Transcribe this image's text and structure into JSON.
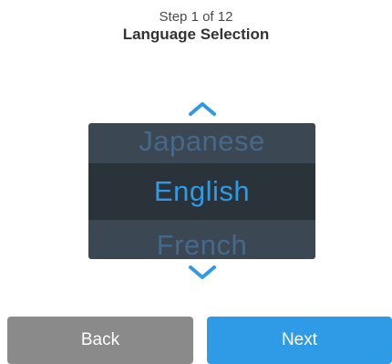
{
  "header": {
    "step": "Step 1 of 12",
    "title": "Language Selection"
  },
  "picker": {
    "previous": "Japanese",
    "selected": "English",
    "next": "French"
  },
  "icons": {
    "up": "chevron-up-icon",
    "down": "chevron-down-icon"
  },
  "buttons": {
    "back": "Back",
    "next": "Next"
  },
  "colors": {
    "accent": "#2f9be6",
    "picker_bg": "#3b4853",
    "picker_selected_bg": "#2a323a",
    "back_button": "#8a8a8a"
  }
}
